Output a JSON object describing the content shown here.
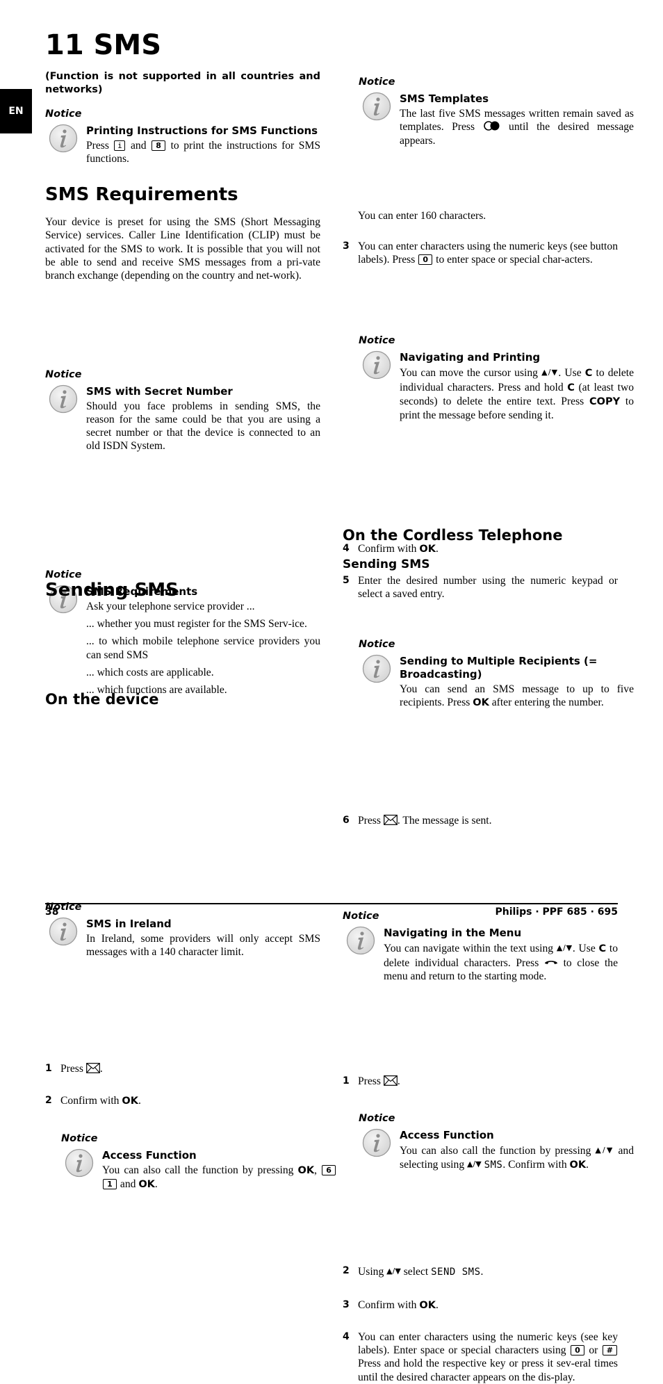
{
  "chapter": {
    "title": "11 SMS",
    "lang_tab": "EN"
  },
  "intro": {
    "note": "(Function is not supported in all countries and networks)"
  },
  "notice_label": "Notice",
  "notices": {
    "printing": {
      "title": "Printing Instructions for SMS Functions",
      "pre": "Press",
      "key1": "i",
      "mid": "and",
      "key2": "8",
      "post": "to print the instructions for SMS functions."
    },
    "secret": {
      "title": "SMS with Secret Number",
      "text": "Should you face problems in sending SMS, the reason for the same could be that you are using a secret number or that the device is connected to an old ISDN System."
    },
    "requirements": {
      "title": "SMS Requirements",
      "lines": [
        "Ask your telephone service provider ...",
        "... whether you must register for the SMS Serv-ice.",
        "... to which mobile telephone service providers you can send SMS",
        "... which costs are applicable.",
        "... which functions are available."
      ]
    },
    "ireland": {
      "title": "SMS in Ireland",
      "text": "In Ireland, some providers will only accept SMS messages with a 140 character limit."
    },
    "access_device": {
      "title": "Access Function",
      "pre": "You can also call the function by pressing",
      "ok": "OK",
      "key1": "6",
      "key2": "1",
      "mid": "and",
      "ok2": "OK",
      "end": "."
    },
    "templates": {
      "title": "SMS Templates",
      "pre": "The last five SMS messages written remain saved as templates. Press",
      "post": "until the desired message appears."
    },
    "nav_print": {
      "title": "Navigating and Printing",
      "t1": "You can move the cursor using",
      "t2": ". Use",
      "c1": "C",
      "t3": "to delete individual characters. Press and hold",
      "c2": "C",
      "t4": "(at least two seconds) to delete the entire text. Press",
      "copy": "COPY",
      "t5": "to print the message before sending it."
    },
    "broadcast": {
      "title": "Sending to Multiple Recipients (= Broadcasting)",
      "pre": "You can send an SMS message to up to five recipients. Press",
      "ok": "OK",
      "post": "after entering the number."
    },
    "nav_menu": {
      "title": "Navigating in the Menu",
      "t1": "You can navigate within the text using",
      "t2": ". Use",
      "c": "C",
      "t3": "to delete individual characters. Press",
      "t4": "to close the menu and return to the starting mode."
    },
    "access_cordless": {
      "title": "Access Function",
      "t1": "You can also call the function by pressing",
      "t2": "and selecting using",
      "lcd": "SMS",
      "t3": ". Confirm with",
      "ok": "OK",
      "end": "."
    }
  },
  "sections": {
    "requirements": {
      "heading": "SMS Requirements",
      "text": "Your device is preset for using the SMS (Short Messaging Service) services. Caller Line Identification (CLIP) must be activated for the SMS to work. It is possible that you will not be able to send and receive SMS messages from a pri-vate branch exchange (depending on the country and net-work)."
    },
    "sending": {
      "heading": "Sending SMS"
    },
    "on_device": {
      "heading": "On the device"
    },
    "cordless": {
      "heading": "On the Cordless Telephone",
      "subheading": "Sending SMS"
    }
  },
  "arrows": "▲/▼",
  "device_steps": {
    "s1": {
      "num": "1",
      "pre": "Press",
      "post": "."
    },
    "s2": {
      "num": "2",
      "pre": "Confirm with",
      "ok": "OK",
      "post": "."
    },
    "s3": {
      "num": "3",
      "pre": "You can enter characters using the numeric keys (see button labels). Press",
      "key": "0",
      "post": "to enter space or special char-acters.",
      "extra": "You can enter 160 characters."
    },
    "s4": {
      "num": "4",
      "pre": "Confirm with",
      "ok": "OK",
      "post": "."
    },
    "s5": {
      "num": "5",
      "text": "Enter the desired number using the numeric keypad or select a saved entry."
    },
    "s6": {
      "num": "6",
      "pre": "Press",
      "post": ". The message is sent."
    }
  },
  "cordless_steps": {
    "s1": {
      "num": "1",
      "pre": "Press",
      "post": "."
    },
    "s2": {
      "num": "2",
      "pre": "Using",
      "mid": "select",
      "lcd": "SEND SMS",
      "post": "."
    },
    "s3": {
      "num": "3",
      "pre": "Confirm with",
      "ok": "OK",
      "post": "."
    },
    "s4": {
      "num": "4",
      "pre": "You can enter characters using the numeric keys (see key labels). Enter space or special characters using",
      "key1": "0",
      "or": "or",
      "key2": "#",
      "post": "Press and hold the respective key or press it sev-eral times until the desired character appears on the dis-play."
    }
  },
  "footer": {
    "page": "38",
    "product": "Philips · PPF 685 · 695"
  }
}
